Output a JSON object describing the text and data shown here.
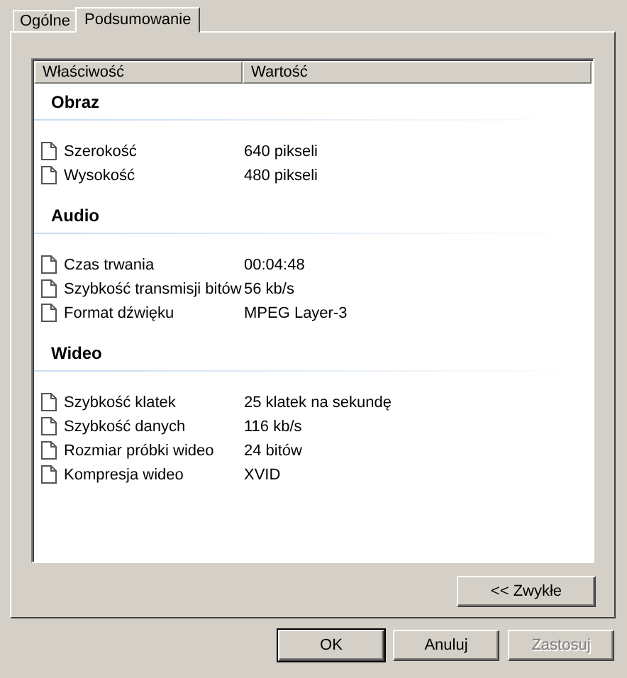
{
  "tabs": [
    {
      "label": "Ogólne",
      "selected": false
    },
    {
      "label": "Podsumowanie",
      "selected": true
    }
  ],
  "list": {
    "columns": [
      "Właściwość",
      "Wartość"
    ],
    "groups": [
      {
        "name": "Obraz",
        "items": [
          {
            "property": "Szerokość",
            "value": "640 pikseli"
          },
          {
            "property": "Wysokość",
            "value": "480 pikseli"
          }
        ]
      },
      {
        "name": "Audio",
        "items": [
          {
            "property": "Czas trwania",
            "value": "00:04:48"
          },
          {
            "property": "Szybkość transmisji bitów",
            "value": "56 kb/s"
          },
          {
            "property": "Format dźwięku",
            "value": "MPEG Layer-3"
          }
        ]
      },
      {
        "name": "Wideo",
        "items": [
          {
            "property": "Szybkość klatek",
            "value": "25 klatek na sekundę"
          },
          {
            "property": "Szybkość danych",
            "value": "116 kb/s"
          },
          {
            "property": "Rozmiar próbki wideo",
            "value": "24 bitów"
          },
          {
            "property": "Kompresja wideo",
            "value": "XVID"
          }
        ]
      }
    ]
  },
  "toggle_button": "<< Zwykłe",
  "buttons": [
    {
      "label": "OK",
      "disabled": false,
      "default": true
    },
    {
      "label": "Anuluj",
      "disabled": false,
      "default": false
    },
    {
      "label": "Zastosuj",
      "disabled": true,
      "default": false
    }
  ]
}
